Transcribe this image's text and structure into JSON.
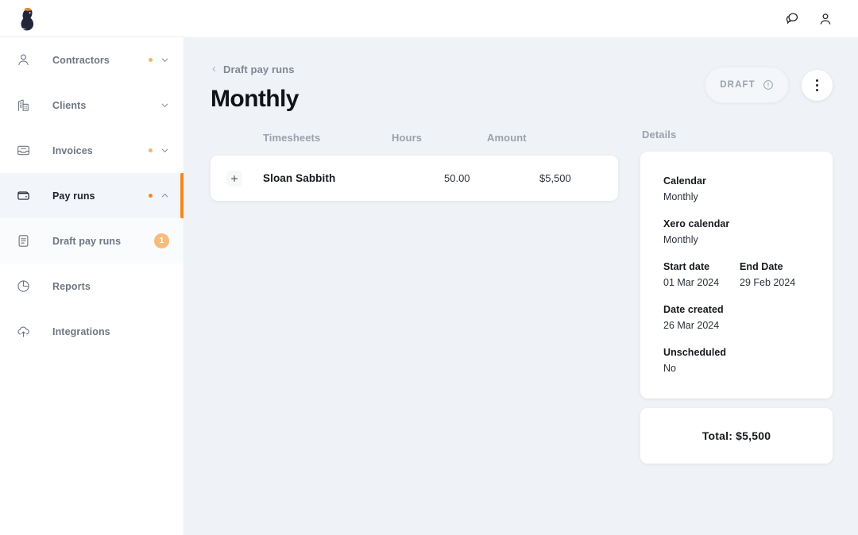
{
  "brand": {
    "logo_icon": "penguin-logo",
    "accent": "#f5861f"
  },
  "topbar": {
    "actions": [
      {
        "name": "messages-icon",
        "label": "Messages"
      },
      {
        "name": "account-icon",
        "label": "Account"
      }
    ]
  },
  "sidebar": {
    "items": [
      {
        "label": "Contractors",
        "icon": "user-icon",
        "dot": true,
        "chevron": "down",
        "active": false,
        "sub": false,
        "badge": ""
      },
      {
        "label": "Clients",
        "icon": "building-icon",
        "dot": false,
        "chevron": "down",
        "active": false,
        "sub": false,
        "badge": ""
      },
      {
        "label": "Invoices",
        "icon": "inbox-icon",
        "dot": true,
        "chevron": "down",
        "active": false,
        "sub": false,
        "badge": ""
      },
      {
        "label": "Pay runs",
        "icon": "wallet-icon",
        "dot": true,
        "chevron": "up",
        "active": true,
        "sub": false,
        "badge": ""
      },
      {
        "label": "Draft pay runs",
        "icon": "document-icon",
        "dot": false,
        "chevron": "",
        "active": false,
        "sub": true,
        "badge": "1"
      },
      {
        "label": "Reports",
        "icon": "pie-chart-icon",
        "dot": false,
        "chevron": "",
        "active": false,
        "sub": false,
        "badge": ""
      },
      {
        "label": "Integrations",
        "icon": "cloud-upload-icon",
        "dot": false,
        "chevron": "",
        "active": false,
        "sub": false,
        "badge": ""
      }
    ]
  },
  "page": {
    "breadcrumb": "Draft pay runs",
    "title": "Monthly",
    "status": "DRAFT",
    "status_icon": "alert-circle-icon",
    "menu_icon": "kebab-menu-icon"
  },
  "table": {
    "headers": {
      "name": "Timesheets",
      "hours": "Hours",
      "amount": "Amount"
    },
    "rows": [
      {
        "expand": "+",
        "name": "Sloan Sabbith",
        "hours": "50.00",
        "amount": "$5,500"
      }
    ]
  },
  "details": {
    "section_label": "Details",
    "fields": [
      {
        "label": "Calendar",
        "value": "Monthly"
      },
      {
        "label": "Xero calendar",
        "value": "Monthly"
      },
      {
        "label": "Start date",
        "value": "01 Mar 2024"
      },
      {
        "label": "End Date",
        "value": "29 Feb 2024"
      },
      {
        "label": "Date created",
        "value": "26 Mar 2024"
      },
      {
        "label": "Unscheduled",
        "value": "No"
      }
    ]
  },
  "total": {
    "text": "Total:  $5,500"
  }
}
